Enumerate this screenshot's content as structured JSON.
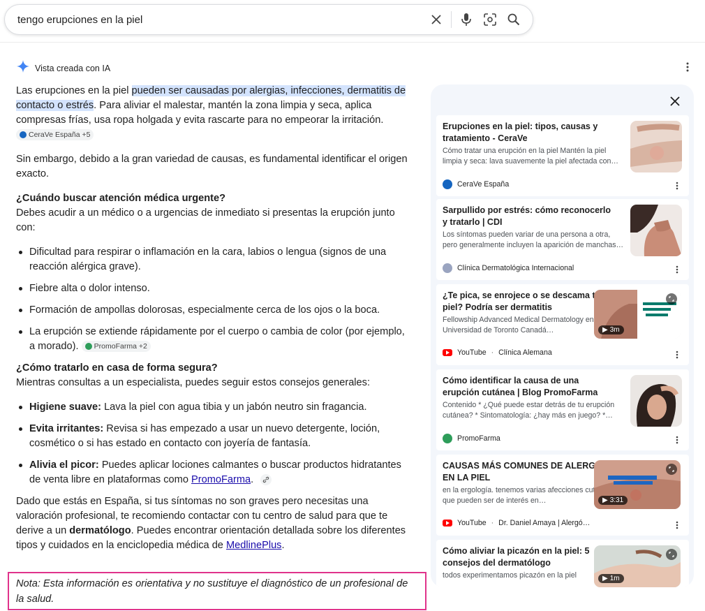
{
  "search": {
    "query": "tengo erupciones en la piel"
  },
  "ai_overview": {
    "header": "Vista creada con IA",
    "p1_a": "Las erupciones en la piel ",
    "p1_hl": "pueden ser causadas por alergias, infecciones, dermatitis de contacto o estrés",
    "p1_b": ". Para aliviar el malestar, mantén la zona limpia y seca, aplica compresas frías, usa ropa holgada y evita rascarte para no empeorar la irritación.",
    "p1_chip": "CeraVe España +5",
    "p2": "Sin embargo, debido a la gran variedad de causas, es fundamental identificar el origen exacto.",
    "h1": "¿Cuándo buscar atención médica urgente?",
    "h1_intro": "Debes acudir a un médico o a urgencias de inmediato si presentas la erupción junto con:",
    "urgent": [
      "Dificultad para respirar o inflamación en la cara, labios o lengua (signos de una reacción alérgica grave).",
      "Fiebre alta o dolor intenso.",
      "Formación de ampollas dolorosas, especialmente cerca de los ojos o la boca.",
      "La erupción se extiende rápidamente por el cuerpo o cambia de color (por ejemplo, a morado)."
    ],
    "urgent_chip": "PromoFarma +2",
    "h2": "¿Cómo tratarlo en casa de forma segura?",
    "h2_intro": "Mientras consultas a un especialista, puedes seguir estos consejos generales:",
    "tips": [
      {
        "bold": "Higiene suave:",
        "text": " Lava la piel con agua tibia y un jabón neutro sin fragancia."
      },
      {
        "bold": "Evita irritantes:",
        "text": " Revisa si has empezado a usar un nuevo detergente, loción, cosmético o si has estado en contacto con joyería de fantasía."
      },
      {
        "bold": "Alivia el picor:",
        "text": " Puedes aplicar lociones calmantes o buscar productos hidratantes de venta libre en plataformas como ",
        "link": "PromoFarma",
        "end": "."
      }
    ],
    "p3_a": "Dado que estás en España, si tus síntomas no son graves pero necesitas una valoración profesional, te recomiendo contactar con tu centro de salud para que te derive a un ",
    "p3_bold": "dermatólogo",
    "p3_b": ". Puedes encontrar orientación detallada sobre los diferentes tipos y cuidados en la enciclopedia médica de ",
    "p3_link": "MedlinePlus",
    "p3_end": ".",
    "note": "Nota: Esta información es orientativa y no sustituye el diagnóstico de un profesional de la salud."
  },
  "sources": [
    {
      "title": "Erupciones en la piel: tipos, causas y tratamiento - CeraVe",
      "snippet": "Cómo tratar una erupción en la piel Mantén la piel limpia y seca: lava suavemente la piel afectada con…",
      "source": "CeraVe España",
      "favicon_color": "#1565c0"
    },
    {
      "title": "Sarpullido por estrés: cómo reconocerlo y tratarlo | CDI",
      "snippet": "Los síntomas pueden variar de una persona a otra, pero generalmente incluyen la aparición de manchas…",
      "source": "Clínica Dermatológica Internacional",
      "favicon_color": "#9aa4c0"
    },
    {
      "title": "¿Te pica, se enrojece o se descama tu piel? Podría ser dermatitis",
      "snippet": "Fellowship Advanced Medical Dermatology en la Universidad de Toronto Canadá…",
      "source": "YouTube",
      "source2": "Clínica Alemana",
      "duration": "3m",
      "favicon_color": "#ff0000"
    },
    {
      "title": "Cómo identificar la causa de una erupción cutánea | Blog PromoFarma",
      "snippet": "Contenido * ¿Qué puede estar detrás de tu erupción cutánea? * Sintomatología: ¿hay más en juego? *…",
      "source": "PromoFarma",
      "favicon_color": "#2e9d5a"
    },
    {
      "title": "CAUSAS MÁS COMUNES DE ALERGIA EN LA PIEL",
      "snippet": "en la ergología. tenemos varias afecciones cutáneas que pueden ser de interés en…",
      "source": "YouTube",
      "source2": "Dr. Daniel Amaya | Alergó…",
      "duration": "3:31",
      "favicon_color": "#ff0000"
    },
    {
      "title": "Cómo aliviar la picazón en la piel: 5 consejos del dermatólogo",
      "snippet": "todos experimentamos picazón en la piel",
      "duration": "1m"
    }
  ],
  "colors": {
    "highlight": "#d3e3fd",
    "link": "#1a0dab",
    "note_border": "#e0338b",
    "panel_bg": "#f3f6fb"
  }
}
